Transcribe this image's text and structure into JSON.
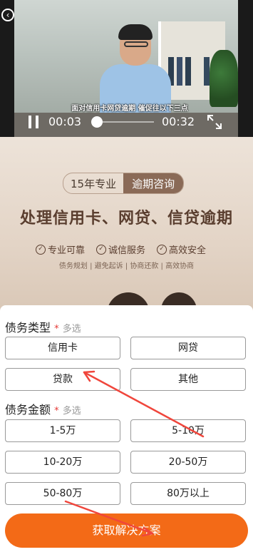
{
  "video": {
    "subtitle": "面对信用卡网贷逾期 催促往以下三点",
    "current_time": "00:03",
    "total_time": "00:32",
    "progress": 0.09
  },
  "banner": {
    "tag_primary": "15年专业",
    "tag_secondary": "逾期咨询",
    "headline": "处理信用卡、网贷、信贷逾期",
    "features": [
      "专业可靠",
      "诚信服务",
      "高效安全"
    ],
    "sub_features": "债务规划 | 避免起诉 | 协商还款 | 高效协商"
  },
  "form": {
    "debt_type": {
      "title": "债务类型",
      "required_mark": "*",
      "hint": "多选",
      "options": [
        "信用卡",
        "网贷",
        "贷款",
        "其他"
      ]
    },
    "debt_amount": {
      "title": "债务金额",
      "required_mark": "*",
      "hint": "多选",
      "options": [
        "1-5万",
        "5-10万",
        "10-20万",
        "20-50万",
        "50-80万",
        "80万以上"
      ]
    },
    "cta_label": "获取解决方案"
  },
  "colors": {
    "accent": "#f36a17",
    "annotation": "#f0463c",
    "brand_brown": "#5a3e2f"
  }
}
